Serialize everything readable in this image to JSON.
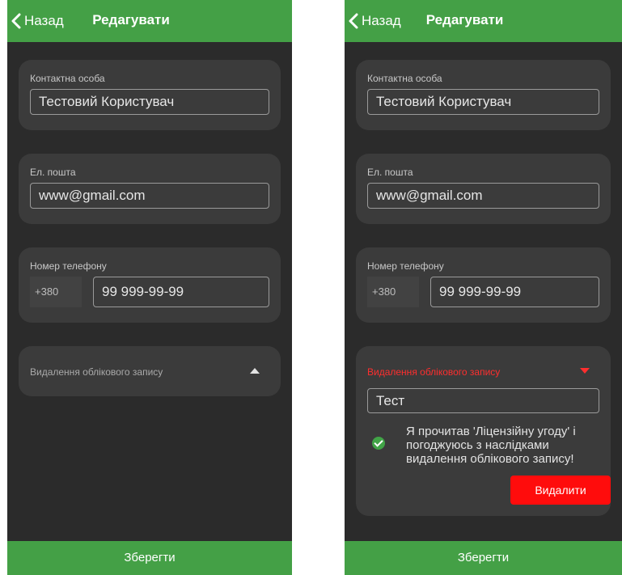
{
  "screens": [
    {
      "header": {
        "back_label": "Назад",
        "title": "Редагувати"
      },
      "contact": {
        "label": "Контактна особа",
        "value": "Тестовий Користувач"
      },
      "email": {
        "label": "Ел. пошта",
        "value": "www@gmail.com"
      },
      "phone": {
        "label": "Номер телефону",
        "prefix": "+380",
        "value": "99 999-99-99"
      },
      "deletion": {
        "title": "Видалення облікового запису",
        "expanded": false,
        "color": "#aaaaaa"
      },
      "save_label": "Зберегти"
    },
    {
      "header": {
        "back_label": "Назад",
        "title": "Редагувати"
      },
      "contact": {
        "label": "Контактна особа",
        "value": "Тестовий Користувач"
      },
      "email": {
        "label": "Ел. пошта",
        "value": "www@gmail.com"
      },
      "phone": {
        "label": "Номер телефону",
        "prefix": "+380",
        "value": "99 999-99-99"
      },
      "deletion": {
        "title": "Видалення облікового запису",
        "expanded": true,
        "color": "#ff2e2e",
        "input_value": "Тест",
        "agreement_text": "Я прочитав 'Ліцензійну угоду' і погоджуюсь з наслідками видалення облікового запису!",
        "agreement_checked": true,
        "delete_label": "Видалити"
      },
      "save_label": "Зберегти"
    }
  ],
  "colors": {
    "accent": "#44a046",
    "background": "#2b2b2b",
    "card": "#3b3b3b",
    "danger": "#ff0c0c"
  }
}
